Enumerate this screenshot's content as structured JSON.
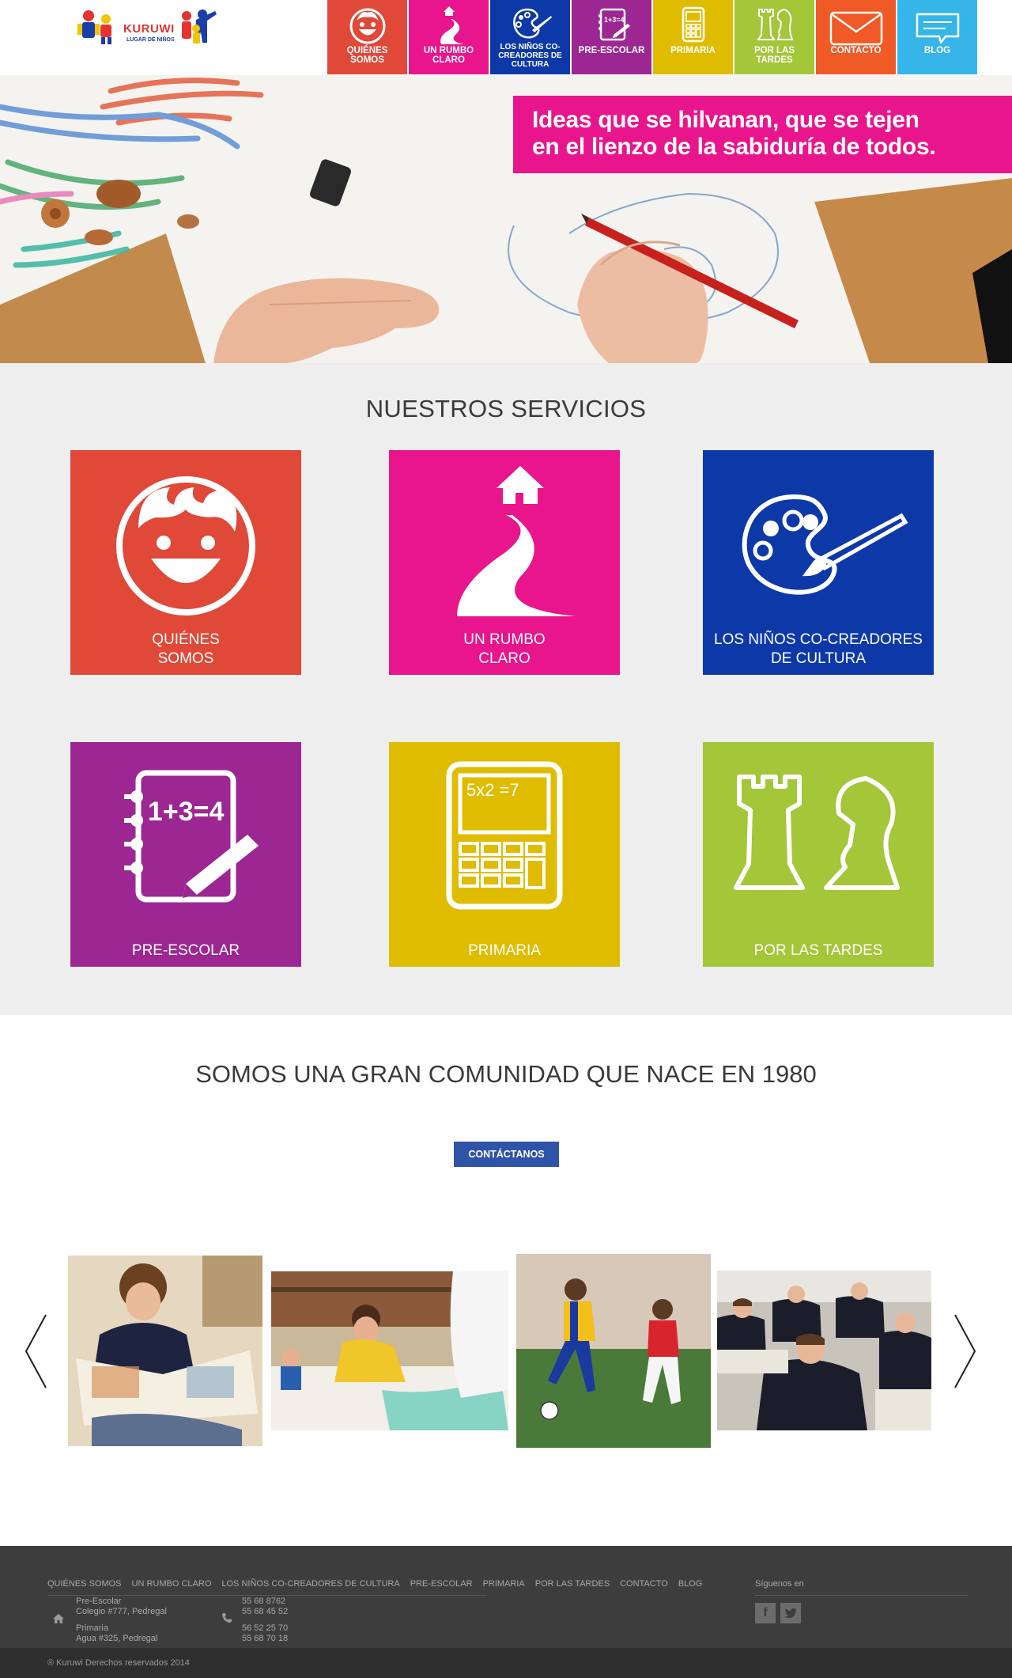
{
  "header": {
    "logo_text": "KURUWI",
    "logo_subtext": "LUGAR DE NIÑOS",
    "nav": [
      {
        "label": "QUIÉNES SOMOS",
        "color": "#e04838",
        "icon": "smiley-face-icon"
      },
      {
        "label": "UN RUMBO CLARO",
        "color": "#e8158c",
        "icon": "road-house-icon"
      },
      {
        "label": "LOS NIÑOS CO-CREADORES DE CULTURA",
        "color": "#0d39a8",
        "icon": "palette-icon"
      },
      {
        "label": "PRE-ESCOLAR",
        "color": "#9c2793",
        "icon": "notebook-icon"
      },
      {
        "label": "PRIMARIA",
        "color": "#e0bc00",
        "icon": "calculator-icon"
      },
      {
        "label": "POR LAS TARDES",
        "color": "#a4c639",
        "icon": "chess-icon"
      },
      {
        "label": "CONTACTO",
        "color": "#ef5a26",
        "icon": "envelope-icon"
      },
      {
        "label": "BLOG",
        "color": "#35b5e8",
        "icon": "speech-bubble-icon"
      }
    ]
  },
  "hero": {
    "banner_line1": "Ideas que se hilvanan, que se tejen",
    "banner_line2": "en el lienzo de la sabiduría de todos.",
    "banner_color": "#e8158c"
  },
  "services": {
    "title": "NUESTROS SERVICIOS",
    "tiles": [
      {
        "label_1": "QUIÉNES",
        "label_2": "SOMOS",
        "color": "#e04838",
        "icon": "smiley-face-icon"
      },
      {
        "label_1": "UN RUMBO",
        "label_2": "CLARO",
        "color": "#e8158c",
        "icon": "road-house-icon"
      },
      {
        "label_1": "LOS NIÑOS CO-CREADORES",
        "label_2": "DE CULTURA",
        "color": "#0d39a8",
        "icon": "palette-icon"
      },
      {
        "label_1": "PRE-ESCOLAR",
        "label_2": "",
        "color": "#9c2793",
        "icon": "notebook-icon"
      },
      {
        "label_1": "PRIMARIA",
        "label_2": "",
        "color": "#e0bc00",
        "icon": "calculator-icon"
      },
      {
        "label_1": "POR LAS TARDES",
        "label_2": "",
        "color": "#a4c639",
        "icon": "chess-icon"
      }
    ],
    "notebook_equation": "1+3=4",
    "calculator_equation": "5x2 =7"
  },
  "community": {
    "title": "SOMOS UNA GRAN COMUNIDAD QUE NACE EN 1980",
    "cta_label": "CONTÁCTANOS",
    "cta_color": "#2f53a7"
  },
  "carousel": {
    "photos": [
      "boy-reading-photo",
      "kids-painting-photo",
      "kids-soccer-photo",
      "students-classroom-photo"
    ]
  },
  "footer": {
    "nav": [
      "QUIÉNES SOMOS",
      "UN RUMBO CLARO",
      "LOS NIÑOS CO-CREADORES DE CULTURA",
      "PRE-ESCOLAR",
      "PRIMARIA",
      "POR LAS TARDES",
      "CONTACTO",
      "BLOG"
    ],
    "address_1_title": "Pre-Escolar",
    "address_1_line": "Colegio #777, Pedregal",
    "address_2_title": "Primaria",
    "address_2_line": "Agua #325, Pedregal",
    "phones_1a": "55 68 8762",
    "phones_1b": "55 68 45 52",
    "phones_2a": "56 52 25 70",
    "phones_2b": "55 68 70 18",
    "follow_label": "Síguenos en",
    "facebook": "f",
    "copyright": "® Kuruwi Derechos reservados 2014"
  }
}
